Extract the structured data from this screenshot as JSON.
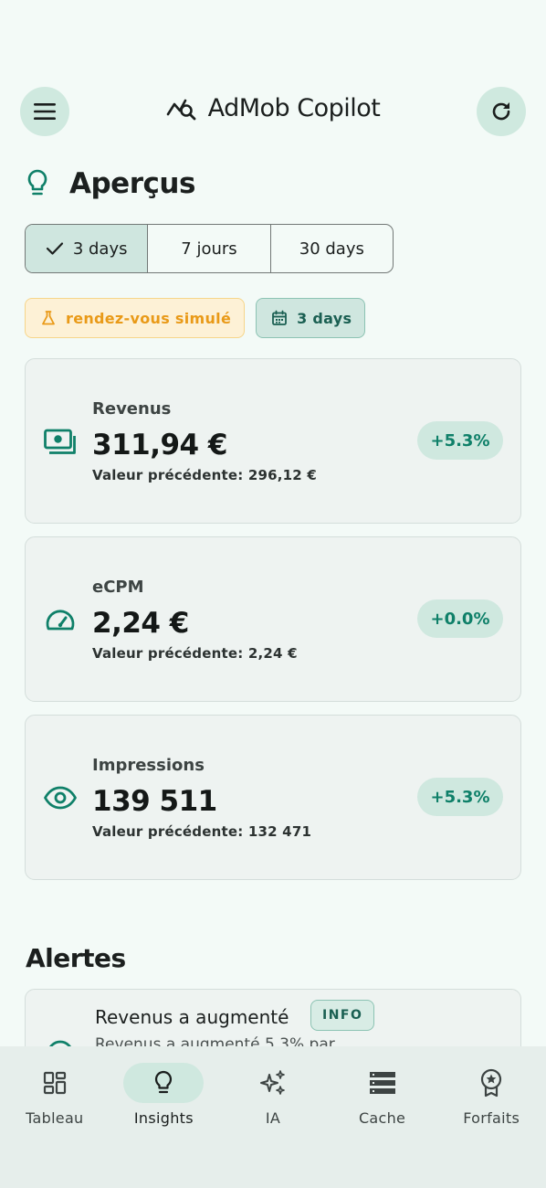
{
  "header": {
    "app_title": "AdMob Copilot",
    "menu_icon": "menu-icon",
    "logo_icon": "chart-search-icon",
    "refresh_icon": "refresh-icon"
  },
  "page": {
    "title": "Aperçus",
    "title_icon": "lightbulb-icon"
  },
  "period_selector": {
    "options": [
      {
        "label": "3 days",
        "selected": true
      },
      {
        "label": "7 jours",
        "selected": false
      },
      {
        "label": "30 days",
        "selected": false
      }
    ]
  },
  "chips": {
    "simulated_label": "rendez-vous simulé",
    "date_label": "3 days"
  },
  "metrics": [
    {
      "label": "Revenus",
      "value": "311,94 €",
      "previous": "Valeur précédente: 296,12 €",
      "delta": "+5.3%",
      "icon": "cash-icon"
    },
    {
      "label": "eCPM",
      "value": "2,24 €",
      "previous": "Valeur précédente: 2,24 €",
      "delta": "+0.0%",
      "icon": "speedometer-icon"
    },
    {
      "label": "Impressions",
      "value": "139 511",
      "previous": "Valeur précédente: 132 471",
      "delta": "+5.3%",
      "icon": "eye-icon"
    }
  ],
  "alerts": {
    "section_title": "Alertes",
    "items": [
      {
        "title": "Revenus a augmenté",
        "badge": "INFO",
        "description": "Revenus a augmenté 5,3% par"
      }
    ]
  },
  "bottom_nav": {
    "items": [
      {
        "label": "Tableau",
        "icon": "dashboard-icon",
        "active": false
      },
      {
        "label": "Insights",
        "icon": "lightbulb-icon",
        "active": true
      },
      {
        "label": "IA",
        "icon": "sparkles-icon",
        "active": false
      },
      {
        "label": "Cache",
        "icon": "storage-icon",
        "active": false
      },
      {
        "label": "Forfaits",
        "icon": "badge-icon",
        "active": false
      }
    ]
  },
  "colors": {
    "accent": "#0f8069",
    "background": "#f3faf7",
    "warning": "#e99a18"
  }
}
